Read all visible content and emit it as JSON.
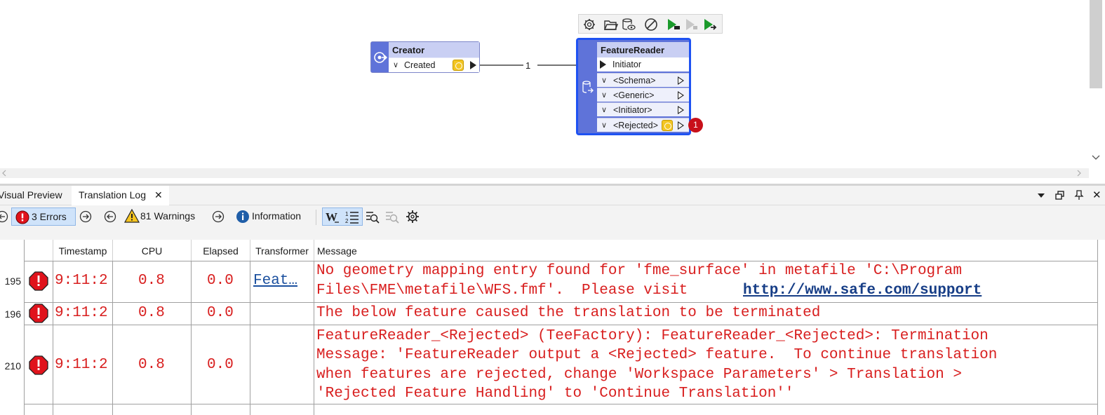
{
  "canvas": {
    "creator": {
      "title": "Creator",
      "port": "Created"
    },
    "connection_label": "1",
    "feature_reader": {
      "title": "FeatureReader",
      "input_port": "Initiator",
      "outputs": [
        "<Schema>",
        "<Generic>",
        "<Initiator>",
        "<Rejected>"
      ],
      "rejected_badge": "1"
    }
  },
  "panel": {
    "tabs": [
      "Visual Preview",
      "Translation Log"
    ],
    "close_glyph": "✕"
  },
  "log_toolbar": {
    "errors_label": "3 Errors",
    "warnings_label": "81 Warnings",
    "information_label": "Information"
  },
  "table": {
    "columns": [
      "Timestamp",
      "CPU",
      "Elapsed",
      "Transformer",
      "Message"
    ],
    "rows": [
      {
        "num": "195",
        "timestamp": "9:11:2",
        "cpu": "0.8",
        "elapsed": "0.0",
        "transformer": "Feat…",
        "message_line1": "No geometry mapping entry found for 'fme_surface' in metafile 'C:\\Program",
        "message_line2": "Files\\FME\\metafile\\WFS.fmf'.  Please visit ",
        "message_link": "http://www.safe.com/support"
      },
      {
        "num": "196",
        "timestamp": "9:11:2",
        "cpu": "0.8",
        "elapsed": "0.0",
        "transformer": "",
        "message_line1": "The below feature caused the translation to be terminated"
      },
      {
        "num": "210",
        "timestamp": "9:11:2",
        "cpu": "0.8",
        "elapsed": "0.0",
        "transformer": "",
        "message_line1": "FeatureReader_<Rejected> (TeeFactory): FeatureReader_<Rejected>: Termination",
        "message_line2": "Message: 'FeatureReader output a <Rejected> feature.  To continue translation",
        "message_line3": "when features are rejected, change 'Workspace Parameters' > Translation >",
        "message_line4": "'Rejected Feature Handling' to 'Continue Translation''"
      }
    ]
  },
  "colors": {
    "node_side": "#5f73d9",
    "node_selected_border": "#1e52f2",
    "error_red": "#d81e1e",
    "link_blue": "#1a4f9e"
  },
  "icons": [
    "gear-icon",
    "open-folder-icon",
    "inspect-cache-icon",
    "disable-icon",
    "run-to-this-icon",
    "run-this-icon",
    "run-from-this-icon",
    "error-icon",
    "warning-icon",
    "information-icon",
    "next-icon",
    "previous-icon",
    "wrap-text-icon",
    "line-numbers-icon",
    "find-icon",
    "filter-icon",
    "settings-icon"
  ]
}
